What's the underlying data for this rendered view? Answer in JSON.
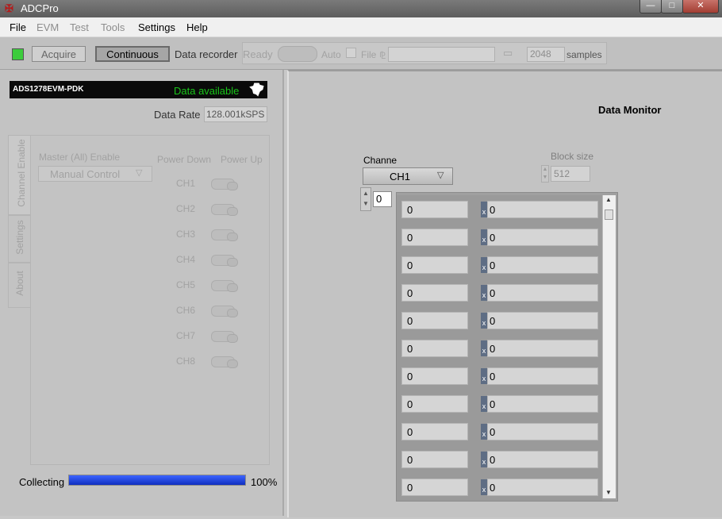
{
  "window": {
    "title": "ADCPro",
    "controls": {
      "minimize": "—",
      "maximize": "□",
      "close": "✕"
    }
  },
  "menu": [
    "File",
    "EVM",
    "Test",
    "Tools",
    "Settings",
    "Help"
  ],
  "toolbar": {
    "acquire": "Acquire",
    "continuous": "Continuous",
    "data_recorder": "Data recorder",
    "status": "Ready",
    "auto": "Auto",
    "file": "File",
    "samples_value": "2048",
    "samples_label": "samples"
  },
  "evm": {
    "name": "ADS1278EVM-PDK",
    "status": "Data available",
    "data_rate_label": "Data Rate",
    "data_rate_value": "128.001kSPS"
  },
  "tabs": [
    "Channel Enable",
    "Settings",
    "About"
  ],
  "channel_enable": {
    "master_label": "Master (All) Enable",
    "master_value": "Manual Control",
    "power_down": "Power Down",
    "power_up": "Power Up",
    "channels": [
      "CH1",
      "CH2",
      "CH3",
      "CH4",
      "CH5",
      "CH6",
      "CH7",
      "CH8"
    ]
  },
  "progress": {
    "label": "Collecting",
    "value": "100%",
    "fraction": 1.0
  },
  "monitor": {
    "title": "Data Monitor",
    "channel_label": "Channe",
    "channel_value": "CH1",
    "block_size_label": "Block size",
    "block_size_value": "512",
    "index_value": "0",
    "rows": [
      {
        "a": "0",
        "b": "0"
      },
      {
        "a": "0",
        "b": "0"
      },
      {
        "a": "0",
        "b": "0"
      },
      {
        "a": "0",
        "b": "0"
      },
      {
        "a": "0",
        "b": "0"
      },
      {
        "a": "0",
        "b": "0"
      },
      {
        "a": "0",
        "b": "0"
      },
      {
        "a": "0",
        "b": "0"
      },
      {
        "a": "0",
        "b": "0"
      },
      {
        "a": "0",
        "b": "0"
      },
      {
        "a": "0",
        "b": "0"
      }
    ],
    "row_marker": "x"
  },
  "colors": {
    "led_green": "#3ccc3c",
    "status_green": "#19c419",
    "progress_blue": "#1a3fd6"
  }
}
